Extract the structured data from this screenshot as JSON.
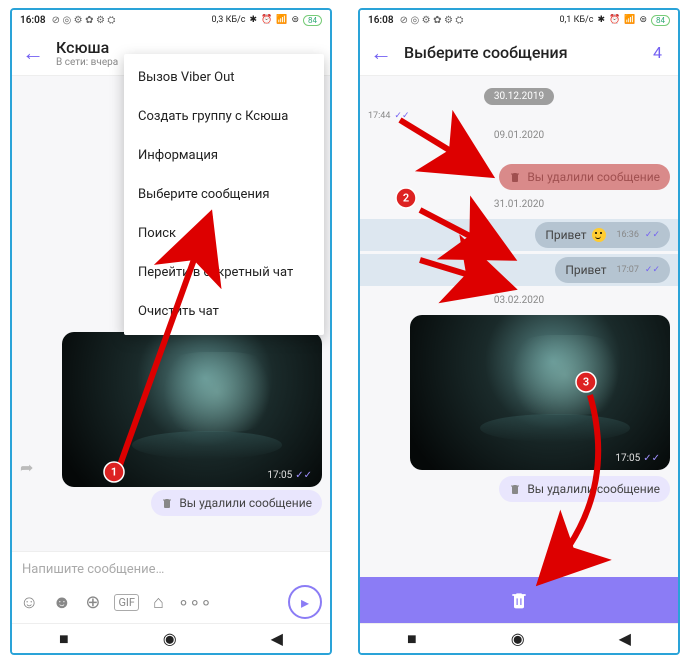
{
  "statusbar": {
    "time": "16:08",
    "data_rate_left": "0,3 КБ/с",
    "data_rate_right": "0,1 КБ/с",
    "battery": "84"
  },
  "left": {
    "header": {
      "title": "Ксюша",
      "subtitle": "В сети: вчера"
    },
    "menu": {
      "call": "Вызов Viber Out",
      "create_group": "Создать группу с Ксюша",
      "info": "Информация",
      "select_msgs": "Выберите сообщения",
      "search": "Поиск",
      "secret": "Перейти в секретный чат",
      "clear": "Очистить чат"
    },
    "image_time": "17:05",
    "deleted_text": "Вы удалили сообщение",
    "composer_placeholder": "Напишите сообщение…",
    "gif_label": "GIF"
  },
  "right": {
    "header": {
      "title": "Выберите сообщения",
      "count": "4"
    },
    "date_chip_1": "30.12.2019",
    "meta_time_1": "17:44",
    "date_2": "09.01.2020",
    "deleted_text": "Вы удалили сообщение",
    "date_3": "31.01.2020",
    "msg1": {
      "text": "Привет",
      "time": "16:36"
    },
    "msg2": {
      "text": "Привет",
      "time": "17:07"
    },
    "date_4": "03.02.2020",
    "image_time": "17:05",
    "deleted_text2": "Вы удалили сообщение"
  }
}
